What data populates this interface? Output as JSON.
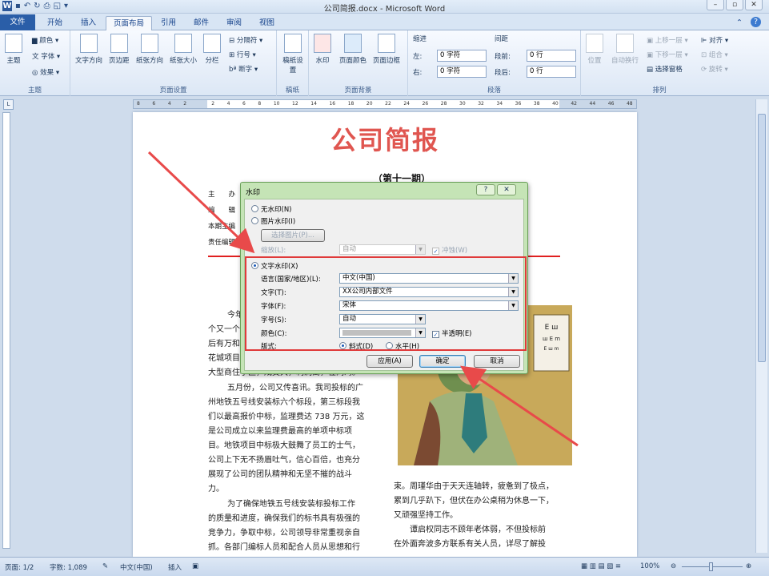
{
  "window": {
    "title": "公司简报.docx - Microsoft Word"
  },
  "tabs": [
    "文件",
    "开始",
    "插入",
    "页面布局",
    "引用",
    "邮件",
    "审阅",
    "视图"
  ],
  "ribbon": {
    "theme": {
      "label": "主题",
      "btn": "主题",
      "colors": "颜色",
      "fonts": "字体",
      "effects": "效果"
    },
    "page_setup": {
      "label": "页面设置",
      "btns": [
        "文字方向",
        "页边距",
        "纸张方向",
        "纸张大小",
        "分栏"
      ],
      "breaks": "分隔符",
      "line_numbers": "行号",
      "hyphen": "断字"
    },
    "draft": {
      "label": "稿纸",
      "btn": "稿纸设置"
    },
    "page_bg": {
      "label": "页面背景",
      "btns": [
        "水印",
        "页面颜色",
        "页面边框"
      ]
    },
    "paragraph": {
      "label": "段落",
      "indent": "缩进",
      "spacing": "间距",
      "left": "左:",
      "right": "右:",
      "before": "段前:",
      "after": "段后:",
      "left_val": "0 字符",
      "right_val": "0 字符",
      "before_val": "0 行",
      "after_val": "0 行"
    },
    "arrange": {
      "label": "排列",
      "position": "位置",
      "wrap": "自动换行",
      "forward": "上移一层",
      "backward": "下移一层",
      "pane": "选择窗格",
      "align": "对齐",
      "group": "组合",
      "rotate": "旋转"
    }
  },
  "ruler_numbers": [
    "8",
    "6",
    "4",
    "2",
    "",
    "2",
    "4",
    "6",
    "8",
    "10",
    "12",
    "14",
    "16",
    "18",
    "20",
    "22",
    "24",
    "26",
    "28",
    "30",
    "32",
    "34",
    "36",
    "38",
    "40",
    "42",
    "44",
    "46",
    "48"
  ],
  "document": {
    "title": "公司简报",
    "issue": "（第十一期）",
    "meta": [
      "主　　办",
      "编　　辑",
      "本期主编",
      "责任编辑"
    ],
    "p_left": [
      "今年",
      "个又一个",
      "后有万和",
      "花城项目",
      "大型商住小区，成交大，利润高，在同湾。"
    ],
    "p_left2": [
      "五月份，公司又传喜讯。我司投标的广",
      "州地铁五号线安装标六个标段，第三标段我",
      "们以最高报价中标，监理费达 738 万元，这",
      "是公司成立以来监理费最高的单项中标项",
      "目。地铁项目中标极大鼓舞了员工的士气，",
      "公司上下无不扬眉吐气，信心百倍，也充分",
      "展现了公司的团队精神和无坚不摧的战斗",
      "力。"
    ],
    "p_left3": [
      "为了确保地铁五号线安装标投标工作",
      "的质量和进度，确保我们的标书具有极强的",
      "竞争力，争取中标，公司领导非常重视亲自",
      "抓。各部门编标人员和配合人员从思想和行"
    ],
    "p_right": [
      "束。周瑾华由于天天连轴转，疲惫到了极点，",
      "累到几乎趴下，但伏在办公桌稍为休息一下，",
      "又顽强坚持工作。",
      "谭启权同志不顾年老体弱，不但投标前",
      "在外面奔波多方联系有关人员，详尽了解投"
    ]
  },
  "dialog": {
    "title": "水印",
    "help": "?",
    "no_watermark": "无水印(N)",
    "picture_watermark": "图片水印(I)",
    "select_picture": "选择图片(P)...",
    "scale_label": "缩放(L):",
    "scale_value": "自动",
    "washout": "冲蚀(W)",
    "text_watermark": "文字水印(X)",
    "language_label": "语言(国家/地区)(L):",
    "language_value": "中文(中国)",
    "text_label": "文字(T):",
    "text_value": "XX公司内部文件",
    "font_label": "字体(F):",
    "font_value": "宋体",
    "size_label": "字号(S):",
    "size_value": "自动",
    "color_label": "颜色(C):",
    "semitransparent": "半透明(E)",
    "layout_label": "版式:",
    "diagonal": "斜式(D)",
    "horizontal": "水平(H)",
    "apply": "应用(A)",
    "ok": "确定",
    "cancel": "取消"
  },
  "status": {
    "page": "页面: 1/2",
    "words": "字数: 1,089",
    "lang": "中文(中国)",
    "mode": "插入",
    "zoom": "100%"
  },
  "colors": {
    "accent": "#2a5ea8",
    "title_red": "#e05650",
    "highlight": "#e03a3a",
    "dialog_frame": "#c5e4b6"
  }
}
